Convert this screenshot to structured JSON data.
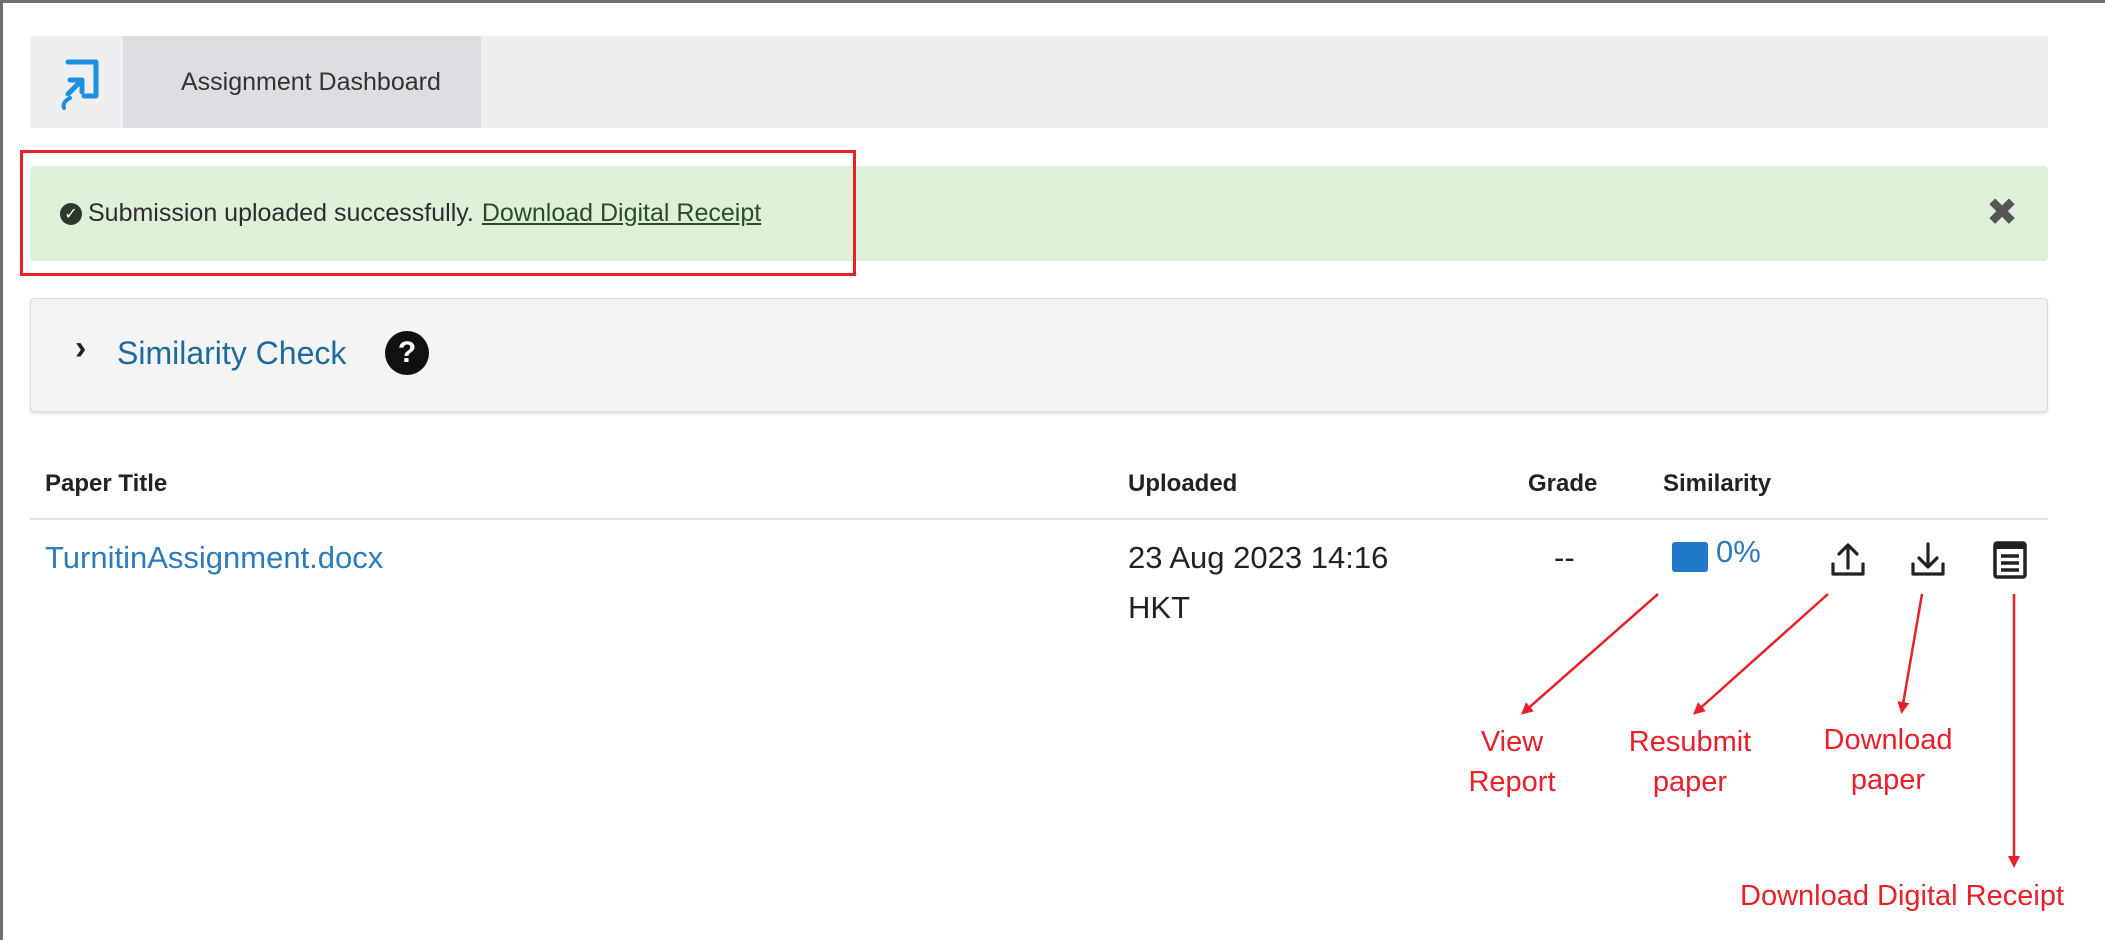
{
  "header": {
    "tab_label": "Assignment Dashboard",
    "logo_icon": "turnitin-logo-icon",
    "accent": "#1b8fe0"
  },
  "alert": {
    "message": "Submission uploaded successfully.",
    "link_label": "Download Digital Receipt",
    "check_icon": "check-circle-icon",
    "close_icon": "close-icon",
    "background": "#dff0d8"
  },
  "similarity_panel": {
    "title": "Similarity Check",
    "expand_icon": "chevron-right-icon",
    "help_icon": "help-icon",
    "help_glyph": "?"
  },
  "table": {
    "columns": [
      "Paper Title",
      "Uploaded",
      "Grade",
      "Similarity"
    ],
    "rows": [
      {
        "paper_title": "TurnitinAssignment.docx",
        "uploaded_date": "23 Aug 2023 14:16",
        "uploaded_tz": "HKT",
        "grade": "--",
        "similarity": "0%",
        "similarity_color": "#1f78c8"
      }
    ],
    "action_icons": [
      "upload-icon",
      "download-icon",
      "receipt-icon"
    ]
  },
  "annotations": {
    "view_report": [
      "View",
      "Report"
    ],
    "resubmit": [
      "Resubmit",
      "paper"
    ],
    "download_paper": [
      "Download",
      "paper"
    ],
    "download_receipt": "Download Digital Receipt",
    "color": "#e8202a"
  }
}
